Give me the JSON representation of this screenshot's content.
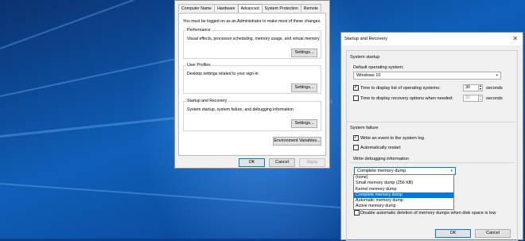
{
  "system_properties": {
    "tabs": [
      "Computer Name",
      "Hardware",
      "Advanced",
      "System Protection",
      "Remote"
    ],
    "admin_note": "You must be logged on as an Administrator to make most of these changes.",
    "performance": {
      "title": "Performance",
      "desc": "Visual effects, processor scheduling, memory usage, and virtual memory",
      "button": "Settings..."
    },
    "user_profiles": {
      "title": "User Profiles",
      "desc": "Desktop settings related to your sign-in",
      "button": "Settings..."
    },
    "startup_recovery": {
      "title": "Startup and Recovery",
      "desc": "System startup, system failure, and debugging information",
      "button": "Settings..."
    },
    "env_button": "Environment Variables...",
    "ok": "OK",
    "cancel": "Cancel",
    "apply": "Apply"
  },
  "startup_and_recovery": {
    "title": "Startup and Recovery",
    "close": "✕",
    "system_startup": "System startup",
    "default_os_label": "Default operating system:",
    "default_os_value": "Windows 10",
    "time_list_label": "Time to display list of operating systems:",
    "time_list_value": "30",
    "time_list_unit": "seconds",
    "time_list_checked": true,
    "time_recovery_label": "Time to display recovery options when needed:",
    "time_recovery_value": "30",
    "time_recovery_unit": "seconds",
    "time_recovery_checked": false,
    "system_failure": "System failure",
    "write_event_label": "Write an event to the system log",
    "write_event_checked": true,
    "auto_restart_label": "Automatically restart",
    "auto_restart_checked": false,
    "write_debug_label": "Write debugging information",
    "debug_selected": "Complete memory dump",
    "debug_options": [
      "(none)",
      "Small memory dump (256 KB)",
      "Kernel memory dump",
      "Complete memory dump",
      "Automatic memory dump",
      "Active memory dump"
    ],
    "disable_delete_label": "Disable automatic deletion of memory dumps when disk space is low",
    "ok": "OK",
    "cancel": "Cancel"
  }
}
